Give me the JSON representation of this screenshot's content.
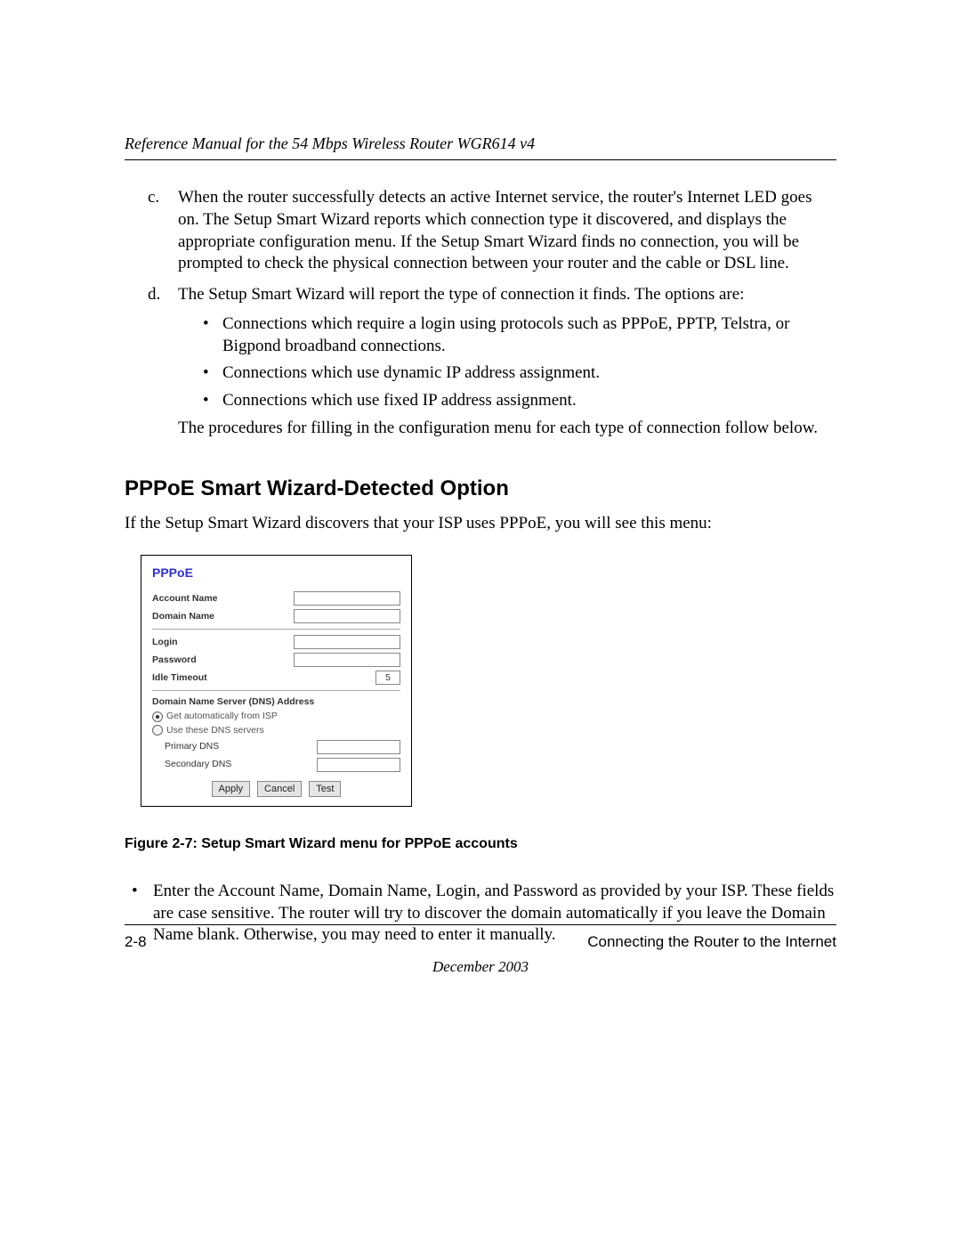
{
  "header": {
    "running_title": "Reference Manual for the 54 Mbps Wireless Router WGR614 v4"
  },
  "list_c": {
    "marker": "c.",
    "text": "When the router successfully detects an active Internet service, the router's Internet LED goes on. The Setup Smart Wizard reports which connection type it discovered, and displays the appropriate configuration menu. If the Setup Smart Wizard finds no connection, you will be prompted to check the physical connection between your router and the cable or DSL line."
  },
  "list_d": {
    "marker": "d.",
    "lead": "The Setup Smart Wizard will report the type of connection it finds. The options are:",
    "bullets": [
      "Connections which require a login using protocols such as PPPoE, PPTP, Telstra, or Bigpond broadband connections.",
      "Connections which use dynamic IP address assignment.",
      "Connections which use fixed IP address assignment."
    ],
    "after": "The procedures for filling in the configuration menu for each type of connection follow below."
  },
  "section_heading": "PPPoE Smart Wizard-Detected Option",
  "intro_para": "If the Setup Smart Wizard discovers that your ISP uses PPPoE, you will see this menu:",
  "figure": {
    "title": "PPPoE",
    "fields": {
      "account_name": "Account Name",
      "domain_name": "Domain Name",
      "login": "Login",
      "password": "Password",
      "idle_timeout": "Idle Timeout",
      "idle_timeout_value": "5",
      "dns_heading": "Domain Name Server (DNS) Address",
      "dns_auto": "Get automatically from ISP",
      "dns_manual": "Use these DNS servers",
      "primary_dns": "Primary DNS",
      "secondary_dns": "Secondary DNS"
    },
    "buttons": {
      "apply": "Apply",
      "cancel": "Cancel",
      "test": "Test"
    }
  },
  "figure_caption": "Figure 2-7:  Setup Smart Wizard menu for PPPoE accounts",
  "final_bullet": "Enter the Account Name, Domain Name, Login, and Password as provided by your ISP. These fields are case sensitive. The router will try to discover the domain automatically if you leave the Domain Name blank. Otherwise, you may need to enter it manually.",
  "footer": {
    "page_num": "2-8",
    "chapter": "Connecting the Router to the Internet",
    "date": "December 2003"
  }
}
